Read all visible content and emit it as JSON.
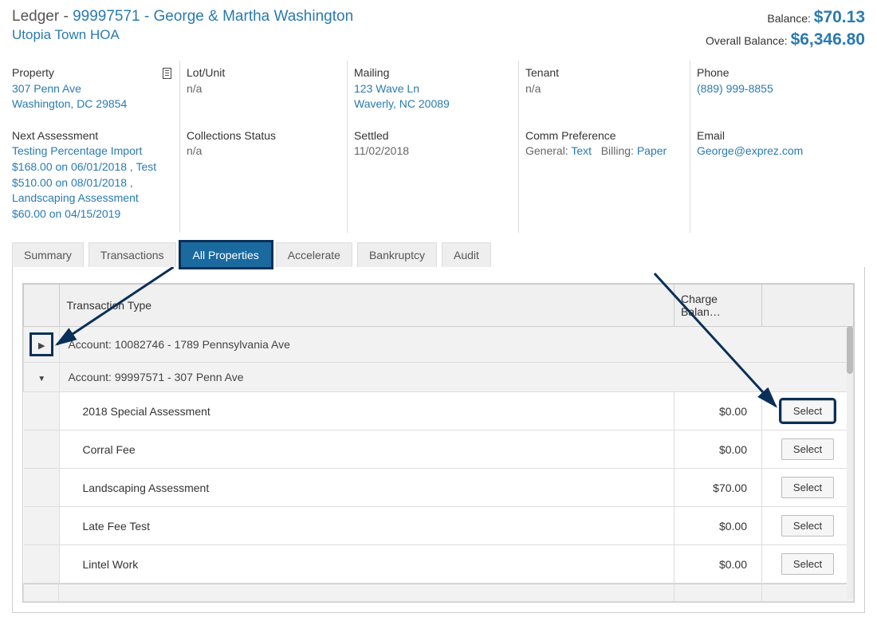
{
  "header": {
    "ledger_label": "Ledger",
    "account_id": "99997571",
    "account_name": "George & Martha Washington",
    "hoa_name": "Utopia Town HOA",
    "balance_label": "Balance:",
    "balance": "$70.13",
    "overall_label": "Overall Balance:",
    "overall_balance": "$6,346.80"
  },
  "info_row1": {
    "property_label": "Property",
    "property_value1": "307 Penn Ave",
    "property_value2": "Washington, DC 29854",
    "lot_label": "Lot/Unit",
    "lot_value": "n/a",
    "mailing_label": "Mailing",
    "mailing_value1": "123 Wave Ln",
    "mailing_value2": "Waverly, NC 20089",
    "tenant_label": "Tenant",
    "tenant_value": "n/a",
    "phone_label": "Phone",
    "phone_value": "(889) 999-8855"
  },
  "info_row2": {
    "next_label": "Next Assessment",
    "next_value": "Testing Percentage Import $168.00 on 06/01/2018 , Test $510.00 on 08/01/2018 , Landscaping Assessment $60.00 on 04/15/2019",
    "coll_label": "Collections Status",
    "coll_value": "n/a",
    "settled_label": "Settled",
    "settled_value": "11/02/2018",
    "comm_label": "Comm Preference",
    "comm_general_label": "General:",
    "comm_general_value": "Text",
    "comm_billing_label": "Billing:",
    "comm_billing_value": "Paper",
    "email_label": "Email",
    "email_value": "George@exprez.com"
  },
  "tabs": {
    "t0": "Summary",
    "t1": "Transactions",
    "t2": "All Properties",
    "t3": "Accelerate",
    "t4": "Bankruptcy",
    "t5": "Audit"
  },
  "table": {
    "col_type": "Transaction Type",
    "col_bal": "Charge Balan…",
    "group1": "Account: 10082746 - 1789 Pennsylvania Ave",
    "group2": "Account: 99997571 - 307 Penn Ave",
    "rows": [
      {
        "name": "2018 Special Assessment",
        "bal": "$0.00"
      },
      {
        "name": "Corral Fee",
        "bal": "$0.00"
      },
      {
        "name": "Landscaping Assessment",
        "bal": "$70.00"
      },
      {
        "name": "Late Fee Test",
        "bal": "$0.00"
      },
      {
        "name": "Lintel Work",
        "bal": "$0.00"
      }
    ],
    "select_label": "Select"
  }
}
